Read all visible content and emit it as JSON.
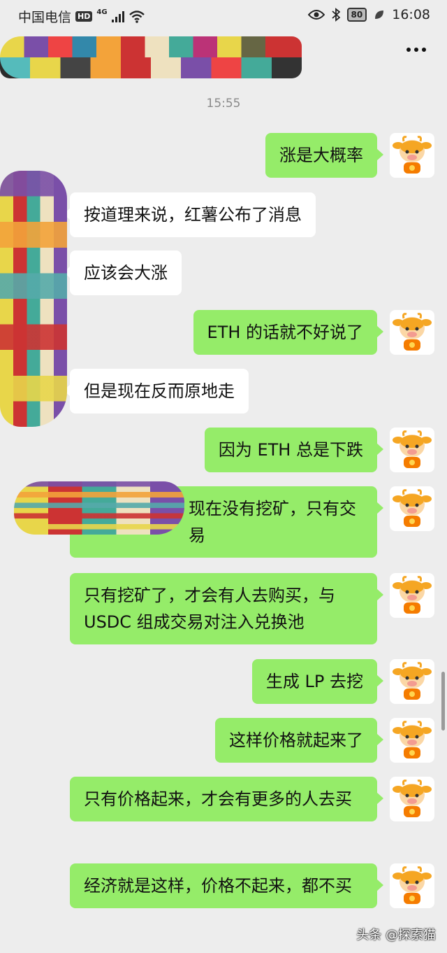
{
  "status_bar": {
    "carrier": "中国电信",
    "hd": "HD",
    "network": "4G",
    "battery": "80",
    "time": "16:08"
  },
  "chat": {
    "timestamp": "15:55",
    "messages": [
      {
        "side": "me",
        "text": "涨是大概率"
      },
      {
        "side": "them",
        "text": "按道理来说，红薯公布了消息"
      },
      {
        "side": "them",
        "text": "应该会大涨"
      },
      {
        "side": "me",
        "text": "ETH 的话就不好说了"
      },
      {
        "side": "them",
        "text": "但是现在反而原地走"
      },
      {
        "side": "me",
        "text": "因为 ETH 总是下跌"
      },
      {
        "side": "me",
        "text": "现在没有挖矿，只有交易"
      },
      {
        "side": "me",
        "text": "只有挖矿了，才会有人去购买，与USDC 组成交易对注入兑换池"
      },
      {
        "side": "me",
        "text": "生成 LP 去挖"
      },
      {
        "side": "me",
        "text": "这样价格就起来了"
      },
      {
        "side": "me",
        "text": "只有价格起来，才会有更多的人去买"
      },
      {
        "side": "me",
        "text": "经济就是这样，价格不起来，都不买"
      }
    ]
  },
  "watermark": "头条 @探索猫",
  "icons": {
    "more": "more-dots-icon",
    "eye": "eye-icon",
    "bluetooth": "bluetooth-icon",
    "leaf": "leaf-icon",
    "wifi": "wifi-icon",
    "avatar": "cartoon-cow-avatar"
  }
}
